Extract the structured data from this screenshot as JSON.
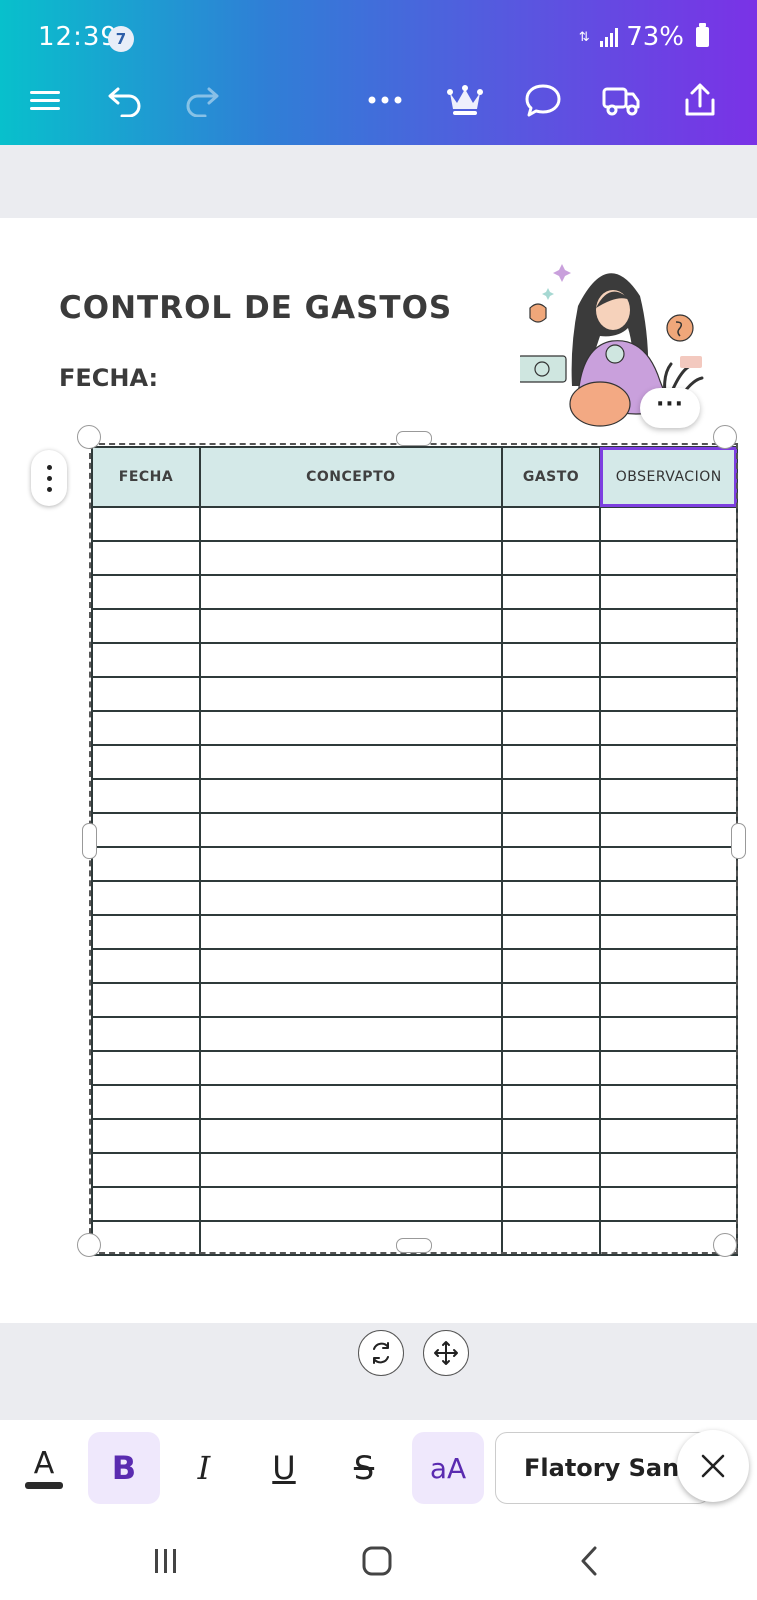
{
  "status_bar": {
    "time": "12:39",
    "notification_count": "7",
    "battery_percent": "73%",
    "icons": [
      "nfc-icon",
      "signal-icon",
      "battery-icon"
    ]
  },
  "top_toolbar": {
    "icons": [
      "menu-icon",
      "undo-icon",
      "redo-icon",
      "more-icon",
      "crown-icon",
      "comment-icon",
      "delivery-truck-icon",
      "share-icon"
    ]
  },
  "document": {
    "title": "CONTROL DE GASTOS",
    "date_label": "FECHA:"
  },
  "table": {
    "headers": [
      "FECHA",
      "CONCEPTO",
      "GASTO",
      "OBSERVACION"
    ],
    "selected_header": "OBSERVACION",
    "empty_row_count": 22
  },
  "text_toolbar": {
    "font_name": "Flatory Sans",
    "tools": [
      "text-color-icon",
      "bold-button",
      "italic-button",
      "underline-button",
      "strikethrough-button",
      "case-button"
    ],
    "bold_label": "B",
    "italic_label": "I",
    "underline_label": "U",
    "strike_label": "S",
    "case_label": "aA",
    "color_label": "A",
    "accent_color": "#5a2bb0",
    "highlight_bg": "#efe8fc"
  },
  "colors": {
    "header_fill": "#d4e9e8",
    "selection_outline": "#7d3fe0"
  }
}
